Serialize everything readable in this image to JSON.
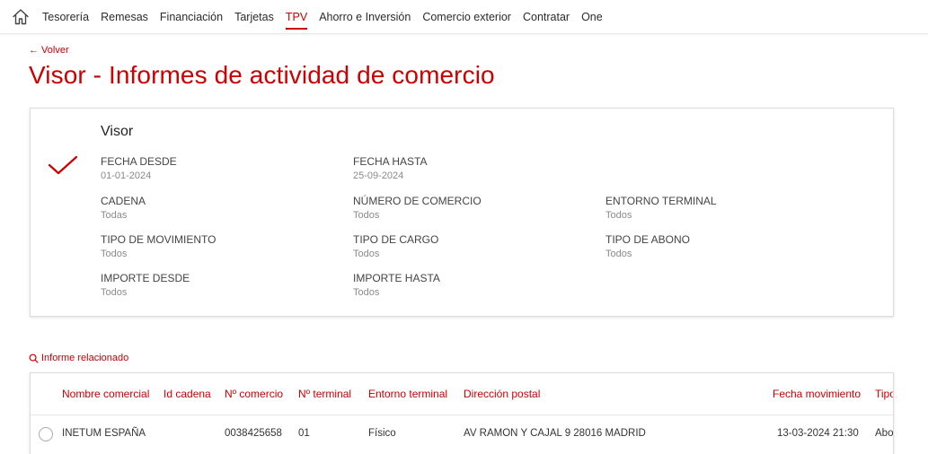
{
  "nav": {
    "items": [
      "Tesorería",
      "Remesas",
      "Financiación",
      "Tarjetas",
      "TPV",
      "Ahorro e Inversión",
      "Comercio exterior",
      "Contratar",
      "One"
    ],
    "active": "TPV"
  },
  "back_label": "← Volver",
  "page_title": "Visor - Informes de actividad de comercio",
  "card": {
    "title": "Visor",
    "fields": {
      "fecha_desde": {
        "label": "FECHA DESDE",
        "value": "01-01-2024"
      },
      "fecha_hasta": {
        "label": "FECHA HASTA",
        "value": "25-09-2024"
      },
      "cadena": {
        "label": "CADENA",
        "value": "Todas"
      },
      "numero_comercio": {
        "label": "NÚMERO DE COMERCIO",
        "value": "Todos"
      },
      "entorno_terminal": {
        "label": "ENTORNO TERMINAL",
        "value": "Todos"
      },
      "tipo_movimiento": {
        "label": "TIPO DE MOVIMIENTO",
        "value": "Todos"
      },
      "tipo_cargo": {
        "label": "TIPO DE CARGO",
        "value": "Todos"
      },
      "tipo_abono": {
        "label": "TIPO DE ABONO",
        "value": "Todos"
      },
      "importe_desde": {
        "label": "IMPORTE DESDE",
        "value": "Todos"
      },
      "importe_hasta": {
        "label": "IMPORTE HASTA",
        "value": "Todos"
      }
    }
  },
  "related_label": "Informe relacionado",
  "table": {
    "headers": {
      "nombre": "Nombre comercial",
      "id_cadena": "Id cadena",
      "n_comercio": "Nº comercio",
      "n_terminal": "Nº terminal",
      "entorno": "Entorno terminal",
      "direccion": "Dirección postal",
      "fecha": "Fecha movimiento",
      "tipo": "Tipo"
    },
    "rows": [
      {
        "nombre": "INETUM ESPAÑA",
        "id_cadena": "",
        "n_comercio": "0038425658",
        "n_terminal": "01",
        "entorno": "Físico",
        "direccion": "AV RAMON Y CAJAL 9 28016 MADRID",
        "fecha": "13-03-2024 21:30",
        "tipo": "Abono"
      }
    ]
  },
  "colors": {
    "accent": "#cc0000",
    "text": "#333333",
    "muted": "#8a8a8a"
  },
  "icons": {
    "home": "home-icon",
    "check": "checkmark-icon",
    "search": "search-icon"
  }
}
